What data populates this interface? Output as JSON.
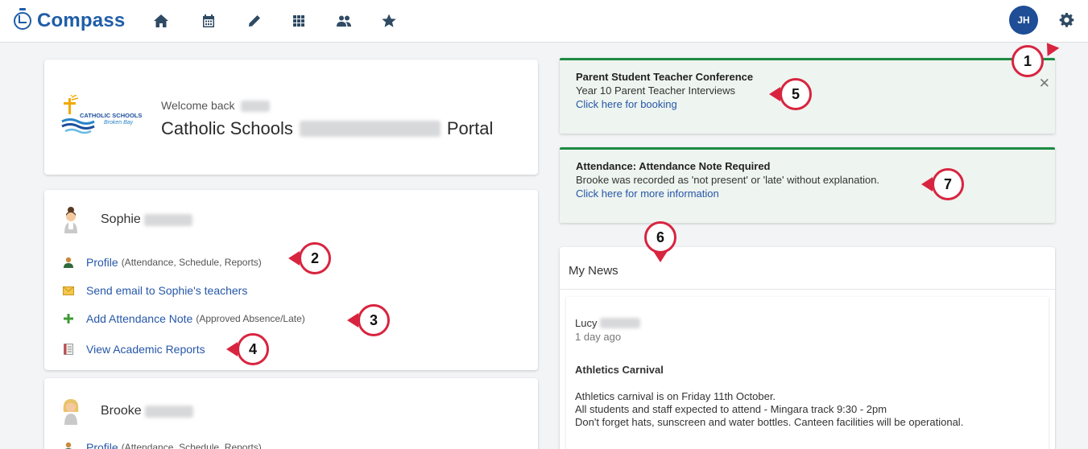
{
  "header": {
    "brand": "Compass",
    "nav_icons": [
      "home-icon",
      "calendar-icon",
      "pencil-icon",
      "grid-icon",
      "people-icon",
      "star-icon"
    ],
    "avatar_initials": "JH",
    "settings_icon": "gear-icon"
  },
  "welcome": {
    "greeting": "Welcome back",
    "title_prefix": "Catholic Schools",
    "title_suffix": "Portal",
    "logo_text": "CATHOLIC SCHOOLS",
    "logo_subtext": "Broken Bay"
  },
  "students": [
    {
      "name": "Sophie",
      "links": [
        {
          "label": "Profile",
          "sub": "(Attendance, Schedule, Reports)",
          "icon": "profile-icon"
        },
        {
          "label": "Send email to Sophie's teachers",
          "sub": "",
          "icon": "email-icon"
        },
        {
          "label": "Add Attendance Note",
          "sub": "(Approved Absence/Late)",
          "icon": "plus-icon"
        },
        {
          "label": "View Academic Reports",
          "sub": "",
          "icon": "report-icon"
        }
      ]
    },
    {
      "name": "Brooke",
      "links": [
        {
          "label": "Profile",
          "sub": "(Attendance, Schedule, Reports)",
          "icon": "profile-icon"
        }
      ]
    }
  ],
  "notices": [
    {
      "title": "Parent Student Teacher Conference",
      "text": "Year 10 Parent Teacher Interviews",
      "link": "Click here for booking",
      "close": "✕"
    },
    {
      "title": "Attendance: Attendance Note Required",
      "text": "Brooke was recorded as 'not present' or 'late' without explanation.",
      "link": "Click here for more information"
    }
  ],
  "news": {
    "header": "My News",
    "author": "Lucy",
    "time": "1 day ago",
    "title": "Athletics Carnival",
    "body": [
      "Athletics carnival is on Friday 11th October.",
      "All students and staff expected to attend - Mingara track 9:30 - 2pm",
      "Don't forget hats, sunscreen and water bottles. Canteen facilities will be operational."
    ]
  },
  "callouts": [
    "1",
    "2",
    "3",
    "4",
    "5",
    "6",
    "7"
  ],
  "colors": {
    "brand": "#1f5da8",
    "link": "#2657a8",
    "notice_accent": "#1e8a43",
    "callout": "#d8243f",
    "avatar": "#1f4d96"
  }
}
